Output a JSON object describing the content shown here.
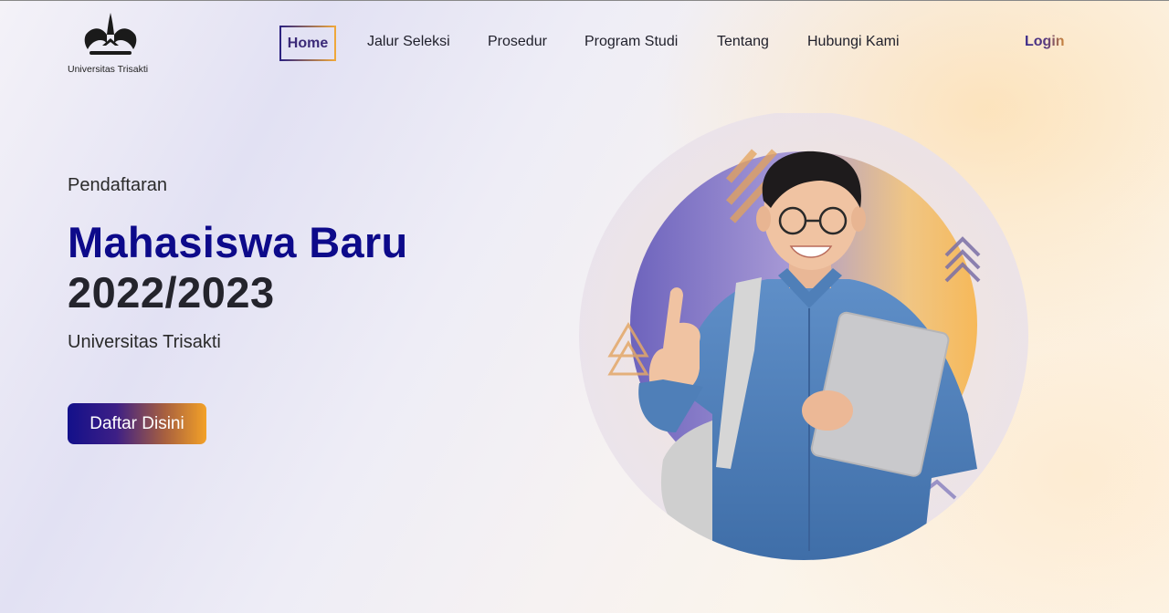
{
  "header": {
    "logo_text": "Universitas Trisakti",
    "nav": [
      {
        "label": "Home",
        "active": true
      },
      {
        "label": "Jalur Seleksi",
        "active": false
      },
      {
        "label": "Prosedur",
        "active": false
      },
      {
        "label": "Program Studi",
        "active": false
      },
      {
        "label": "Tentang",
        "active": false
      },
      {
        "label": "Hubungi Kami",
        "active": false
      }
    ],
    "login_label": "Login"
  },
  "hero": {
    "eyebrow": "Pendaftaran",
    "title_line1": "Mahasiswa Baru",
    "title_line2": "2022/2023",
    "subtitle": "Universitas Trisakti",
    "cta_label": "Daftar Disini"
  },
  "colors": {
    "primary": "#0d0a8a",
    "accent": "#f3a127",
    "text": "#24242c"
  },
  "icons": [
    "university-logo-icon",
    "student-photo",
    "triangle-decor-icon",
    "chevrons-up-icon",
    "diamond-decor-icon",
    "stripes-decor-icon"
  ]
}
